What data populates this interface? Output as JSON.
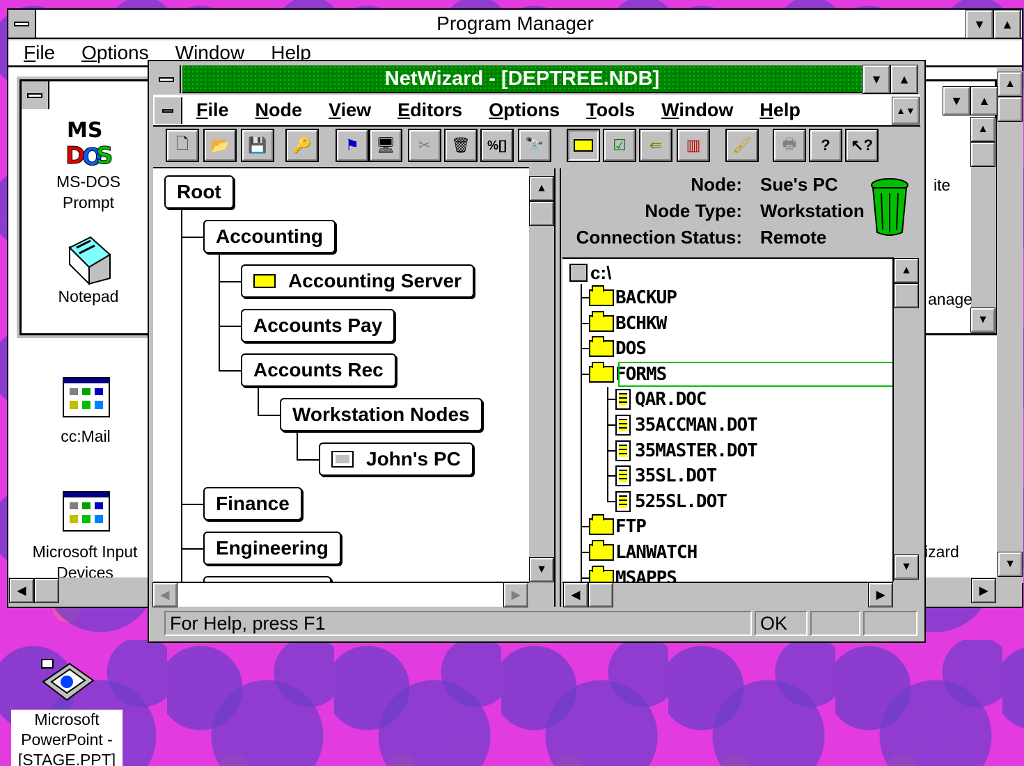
{
  "program_manager": {
    "title": "Program Manager",
    "menu": [
      "File",
      "Options",
      "Window",
      "Help"
    ],
    "icons": [
      {
        "label": "MS-DOS\nPrompt",
        "icon": "ms-dos-icon"
      },
      {
        "label": "Notepad",
        "icon": "notepad-icon"
      },
      {
        "label": "cc:Mail",
        "icon": "program-group-icon"
      },
      {
        "label": "Microsoft Input\nDevices",
        "icon": "program-group-icon"
      }
    ],
    "right_partial_labels": [
      "ite",
      "anage",
      "izard"
    ]
  },
  "netwizard": {
    "title": "NetWizard - [DEPTREE.NDB]",
    "menu": [
      "File",
      "Node",
      "View",
      "Editors",
      "Options",
      "Tools",
      "Window",
      "Help"
    ],
    "toolbar": [
      "new-icon",
      "open-icon",
      "save-icon",
      "key-icon",
      "node-icon",
      "computer-icon",
      "cut-icon",
      "delete-icon",
      "percent-icon",
      "find-icon",
      "folder-icon",
      "check-icon",
      "back-icon",
      "books-icon",
      "brush-icon",
      "print-icon",
      "help-icon",
      "context-help-icon"
    ],
    "tree": {
      "root": "Root",
      "accounting": "Accounting",
      "accounting_server": "Accounting Server",
      "accounts_pay": "Accounts Pay",
      "accounts_rec": "Accounts Rec",
      "workstation_nodes": "Workstation Nodes",
      "johns_pc": "John's PC",
      "finance": "Finance",
      "engineering": "Engineering"
    },
    "info": {
      "node_label": "Node:",
      "node_value": "Sue's PC",
      "type_label": "Node Type:",
      "type_value": "Workstation",
      "status_label": "Connection Status:",
      "status_value": "Remote"
    },
    "files": {
      "drive": "c:\\",
      "folders_top": [
        "BACKUP",
        "BCHKW",
        "DOS",
        "FORMS"
      ],
      "forms_files": [
        "QAR.DOC",
        "35ACCMAN.DOT",
        "35MASTER.DOT",
        "35SL.DOT",
        "525SL.DOT"
      ],
      "folders_bottom": [
        "FTP",
        "LANWATCH",
        "MSAPPS"
      ]
    },
    "status": {
      "help": "For Help, press F1",
      "ok": "OK"
    }
  },
  "desktop": {
    "powerpoint_label": "Microsoft\nPowerPoint -\n[STAGE.PPT]"
  }
}
